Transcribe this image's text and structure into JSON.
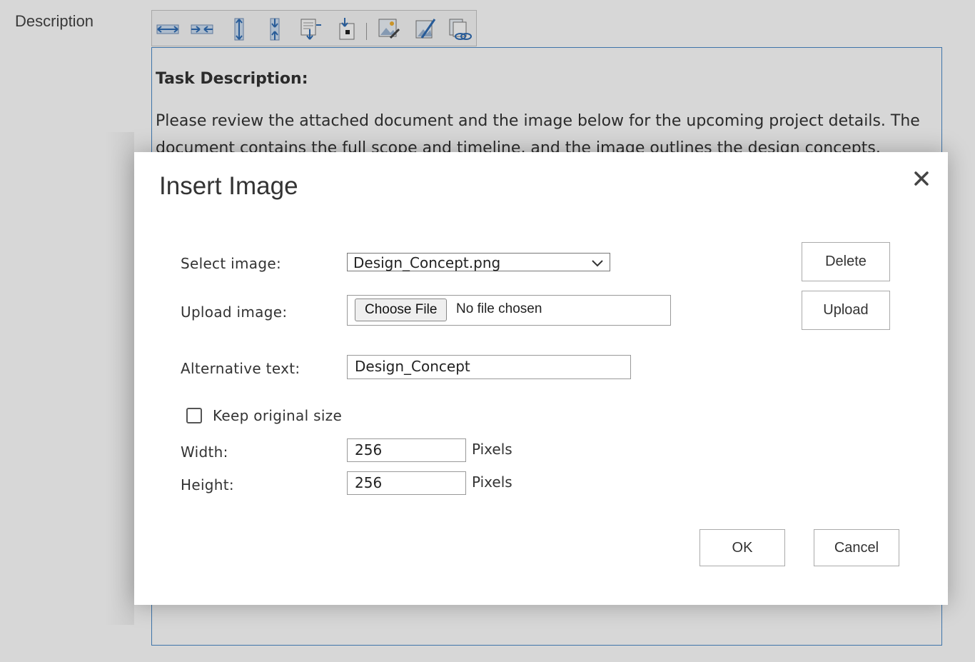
{
  "page": {
    "field_label": "Description",
    "editor": {
      "heading": "Task Description:",
      "body": "Please review the attached document and the image below for the upcoming project details. The document contains the full scope and timeline, and the image outlines the design concepts."
    },
    "toolbar_icons": [
      "resize-horizontal-icon",
      "shrink-horizontal-icon",
      "resize-vertical-icon",
      "shrink-vertical-icon",
      "page-break-after-icon",
      "page-break-before-icon",
      "edit-image-icon",
      "image-properties-icon",
      "image-link-icon"
    ]
  },
  "dialog": {
    "title": "Insert Image",
    "close_icon": "close-icon",
    "select_image": {
      "label": "Select image:",
      "value": "Design_Concept.png"
    },
    "upload_image": {
      "label": "Upload image:",
      "choose_label": "Choose File",
      "status": "No file chosen"
    },
    "alt_text": {
      "label": "Alternative text:",
      "value": "Design_Concept"
    },
    "keep_original": {
      "label": "Keep original size",
      "checked": false
    },
    "width": {
      "label": "Width:",
      "value": "256",
      "unit": "Pixels"
    },
    "height": {
      "label": "Height:",
      "value": "256",
      "unit": "Pixels"
    },
    "buttons": {
      "delete": "Delete",
      "upload": "Upload",
      "ok": "OK",
      "cancel": "Cancel"
    }
  }
}
